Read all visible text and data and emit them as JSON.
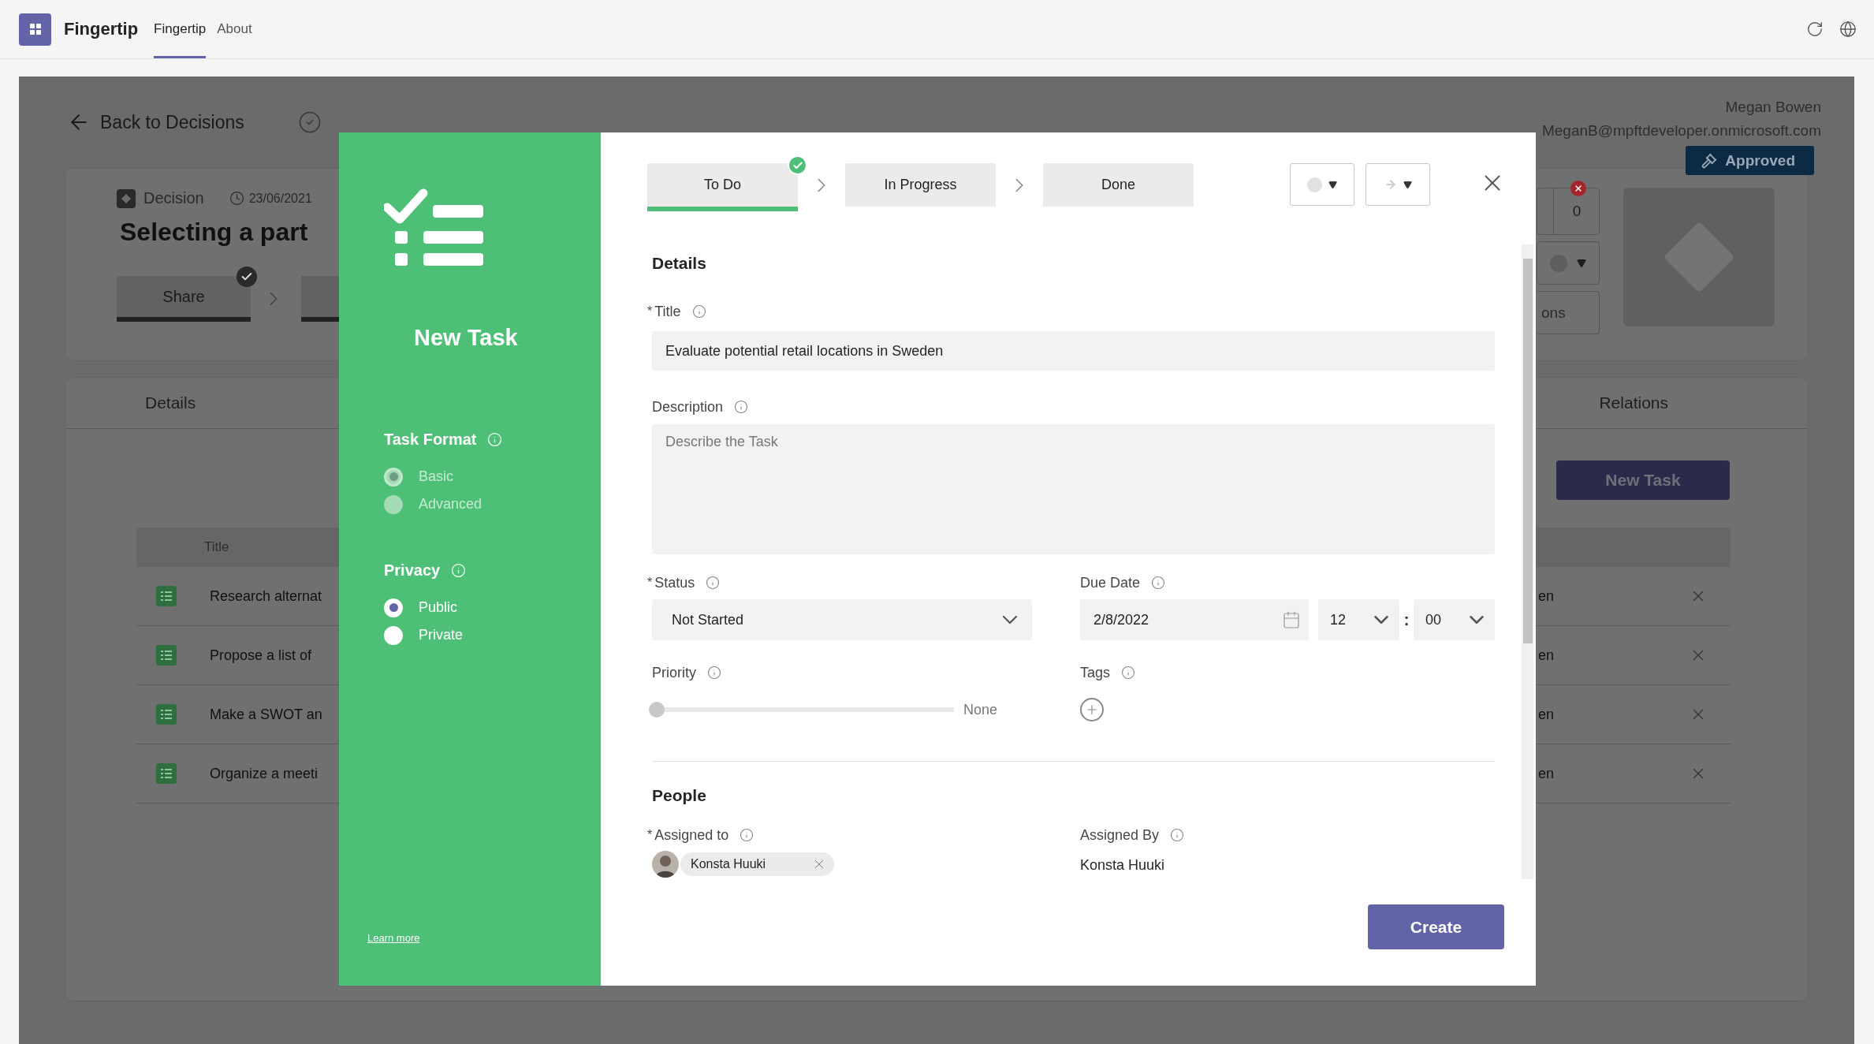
{
  "app_bar": {
    "app_name": "Fingertip",
    "tabs": [
      {
        "label": "Fingertip",
        "selected": true
      },
      {
        "label": "About",
        "selected": false
      }
    ]
  },
  "backdrop": {
    "back_link": "Back to Decisions",
    "user": {
      "name": "Megan Bowen",
      "email": "MeganB@mpftdeveloper.onmicrosoft.com"
    },
    "decision": {
      "type_label": "Decision",
      "date": "23/06/2021",
      "title": "Selecting a part",
      "badge": "Approved",
      "share_step": {
        "label": "Share",
        "done": true
      },
      "counter": "0",
      "actions_button": "ons"
    },
    "tabs": [
      "Details",
      "Relations"
    ],
    "new_task_button": "New Task",
    "table": {
      "column": "Title",
      "rows": [
        {
          "title": "Research alternat",
          "column_2": "en"
        },
        {
          "title": "Propose a list of",
          "column_2": "en"
        },
        {
          "title": "Make a SWOT an",
          "column_2": "en"
        },
        {
          "title": "Organize a meeti",
          "column_2": "en"
        }
      ]
    }
  },
  "modal": {
    "sidebar": {
      "title": "New Task",
      "task_format": {
        "label": "Task Format",
        "options": [
          {
            "label": "Basic",
            "selected": true,
            "disabled": true
          },
          {
            "label": "Advanced",
            "selected": false,
            "disabled": true
          }
        ]
      },
      "privacy": {
        "label": "Privacy",
        "options": [
          {
            "label": "Public",
            "selected": true,
            "disabled": false
          },
          {
            "label": "Private",
            "selected": false,
            "disabled": false
          }
        ]
      },
      "learn_more": "Learn more"
    },
    "steps": [
      {
        "label": "To Do",
        "selected": true,
        "done": true
      },
      {
        "label": "In Progress",
        "selected": false,
        "done": false
      },
      {
        "label": "Done",
        "selected": false,
        "done": false
      }
    ],
    "form": {
      "required_mark": "*",
      "details_heading": "Details",
      "title": {
        "label": "Title",
        "required": true,
        "value": "Evaluate potential retail locations in Sweden"
      },
      "description": {
        "label": "Description",
        "required": false,
        "placeholder": "Describe the Task"
      },
      "status": {
        "label": "Status",
        "required": true,
        "value": "Not Started"
      },
      "due_date": {
        "label": "Due Date",
        "required": false,
        "date": "2/8/2022",
        "hour": "12",
        "separator": ":",
        "minute": "00"
      },
      "priority": {
        "label": "Priority",
        "required": false,
        "level": 0,
        "reading": "None"
      },
      "tags": {
        "label": "Tags",
        "required": false
      },
      "people_heading": "People",
      "assigned_to": {
        "label": "Assigned to",
        "required": true,
        "people": [
          {
            "name": "Konsta Huuki"
          }
        ]
      },
      "assigned_by": {
        "label": "Assigned By",
        "required": false,
        "value": "Konsta Huuki"
      }
    },
    "create_button": "Create"
  }
}
